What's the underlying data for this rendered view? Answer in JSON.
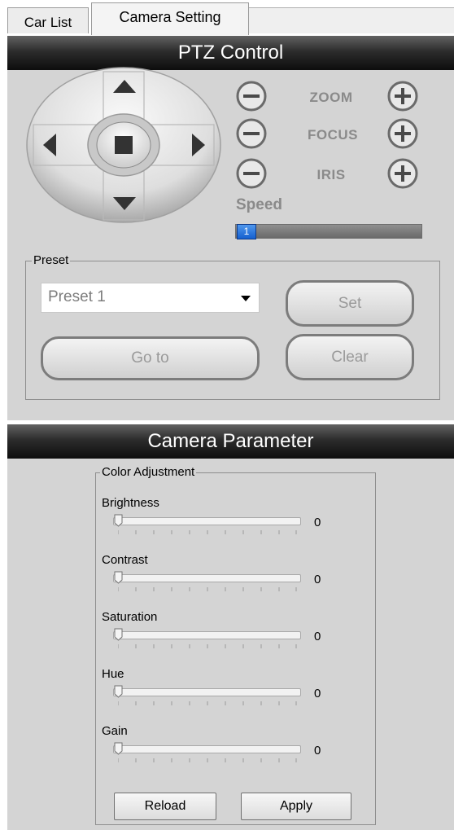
{
  "tabs": [
    {
      "label": "Car List",
      "active": false
    },
    {
      "label": "Camera Setting",
      "active": true
    }
  ],
  "ptz": {
    "header": "PTZ Control",
    "joystick": {
      "up_icon": "arrow-up-icon",
      "down_icon": "arrow-down-icon",
      "left_icon": "arrow-left-icon",
      "right_icon": "arrow-right-icon",
      "stop_icon": "stop-icon"
    },
    "controls": [
      {
        "label": "ZOOM"
      },
      {
        "label": "FOCUS"
      },
      {
        "label": "IRIS"
      }
    ],
    "speed_label": "Speed",
    "speed_value": "1",
    "preset": {
      "legend": "Preset",
      "selected": "Preset 1",
      "set_label": "Set",
      "goto_label": "Go to",
      "clear_label": "Clear"
    }
  },
  "camera": {
    "header": "Camera Parameter",
    "color_adjustment": {
      "legend": "Color Adjustment",
      "sliders": [
        {
          "label": "Brightness",
          "value": "0"
        },
        {
          "label": "Contrast",
          "value": "0"
        },
        {
          "label": "Saturation",
          "value": "0"
        },
        {
          "label": "Hue",
          "value": "0"
        },
        {
          "label": "Gain",
          "value": "0"
        }
      ],
      "reload_label": "Reload",
      "apply_label": "Apply"
    }
  },
  "colors": {
    "header_bar": "#1a1a1a",
    "panel_bg": "#d4d4d4",
    "speed_thumb": "#2f7be0"
  }
}
